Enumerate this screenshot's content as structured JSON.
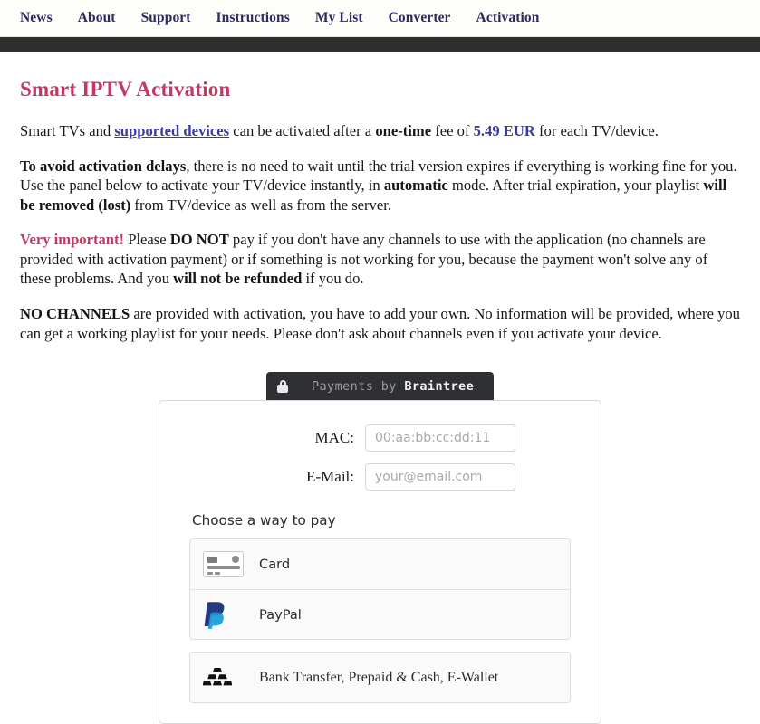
{
  "nav": {
    "items": [
      {
        "label": "News",
        "name": "nav-news"
      },
      {
        "label": "About",
        "name": "nav-about"
      },
      {
        "label": "Support",
        "name": "nav-support"
      },
      {
        "label": "Instructions",
        "name": "nav-instructions"
      },
      {
        "label": "My List",
        "name": "nav-my-list"
      },
      {
        "label": "Converter",
        "name": "nav-converter"
      },
      {
        "label": "Activation",
        "name": "nav-activation"
      }
    ]
  },
  "page": {
    "title": "Smart IPTV Activation",
    "title_color": "#c23a62",
    "link_color": "#3b3b9e",
    "paragraphs": {
      "p1": {
        "t1": "Smart TVs and ",
        "link": "supported devices",
        "t2": " can be activated after a ",
        "b1": "one-time",
        "t3": " fee of ",
        "price": "5.49 EUR",
        "t4": " for each TV/device."
      },
      "p2": {
        "b1": "To avoid activation delays",
        "t1": ", there is no need to wait until the trial version expires if everything is working fine for you. Use the panel below to activate your TV/device instantly, in ",
        "b2": "automatic",
        "t2": " mode. After trial expiration, your playlist ",
        "b3": "will be removed (lost)",
        "t3": " from TV/device as well as from the server."
      },
      "p3": {
        "warn": "Very important!",
        "t1": " Please ",
        "b1": "DO NOT",
        "t2": " pay if you don't have any channels to use with the application (no channels are provided with activation payment) or if something is not working for you, because the payment won't solve any of these problems. And you ",
        "b2": "will not be refunded",
        "t3": " if you do."
      },
      "p4": {
        "b1": "NO CHANNELS",
        "t1": " are provided with activation, you have to add your own. No information will be provided, where you can get a working playlist for your needs. Please don't ask about channels even if you activate your device."
      }
    }
  },
  "braintree": {
    "prefix": "Payments by ",
    "brand": "Braintree",
    "lock_icon": "lock-icon"
  },
  "form": {
    "mac": {
      "label": "MAC:",
      "placeholder": "00:aa:bb:cc:dd:11",
      "value": ""
    },
    "email": {
      "label": "E-Mail:",
      "placeholder": "your@email.com",
      "value": ""
    },
    "choose_label": "Choose a way to pay",
    "methods_primary": [
      {
        "label": "Card",
        "icon": "credit-card-icon",
        "name": "pay-option-card"
      },
      {
        "label": "PayPal",
        "icon": "paypal-icon",
        "name": "pay-option-paypal"
      }
    ],
    "methods_secondary": [
      {
        "label": "Bank Transfer, Prepaid & Cash, E-Wallet",
        "icon": "gold-bars-icon",
        "name": "pay-option-bank-transfer"
      }
    ]
  }
}
